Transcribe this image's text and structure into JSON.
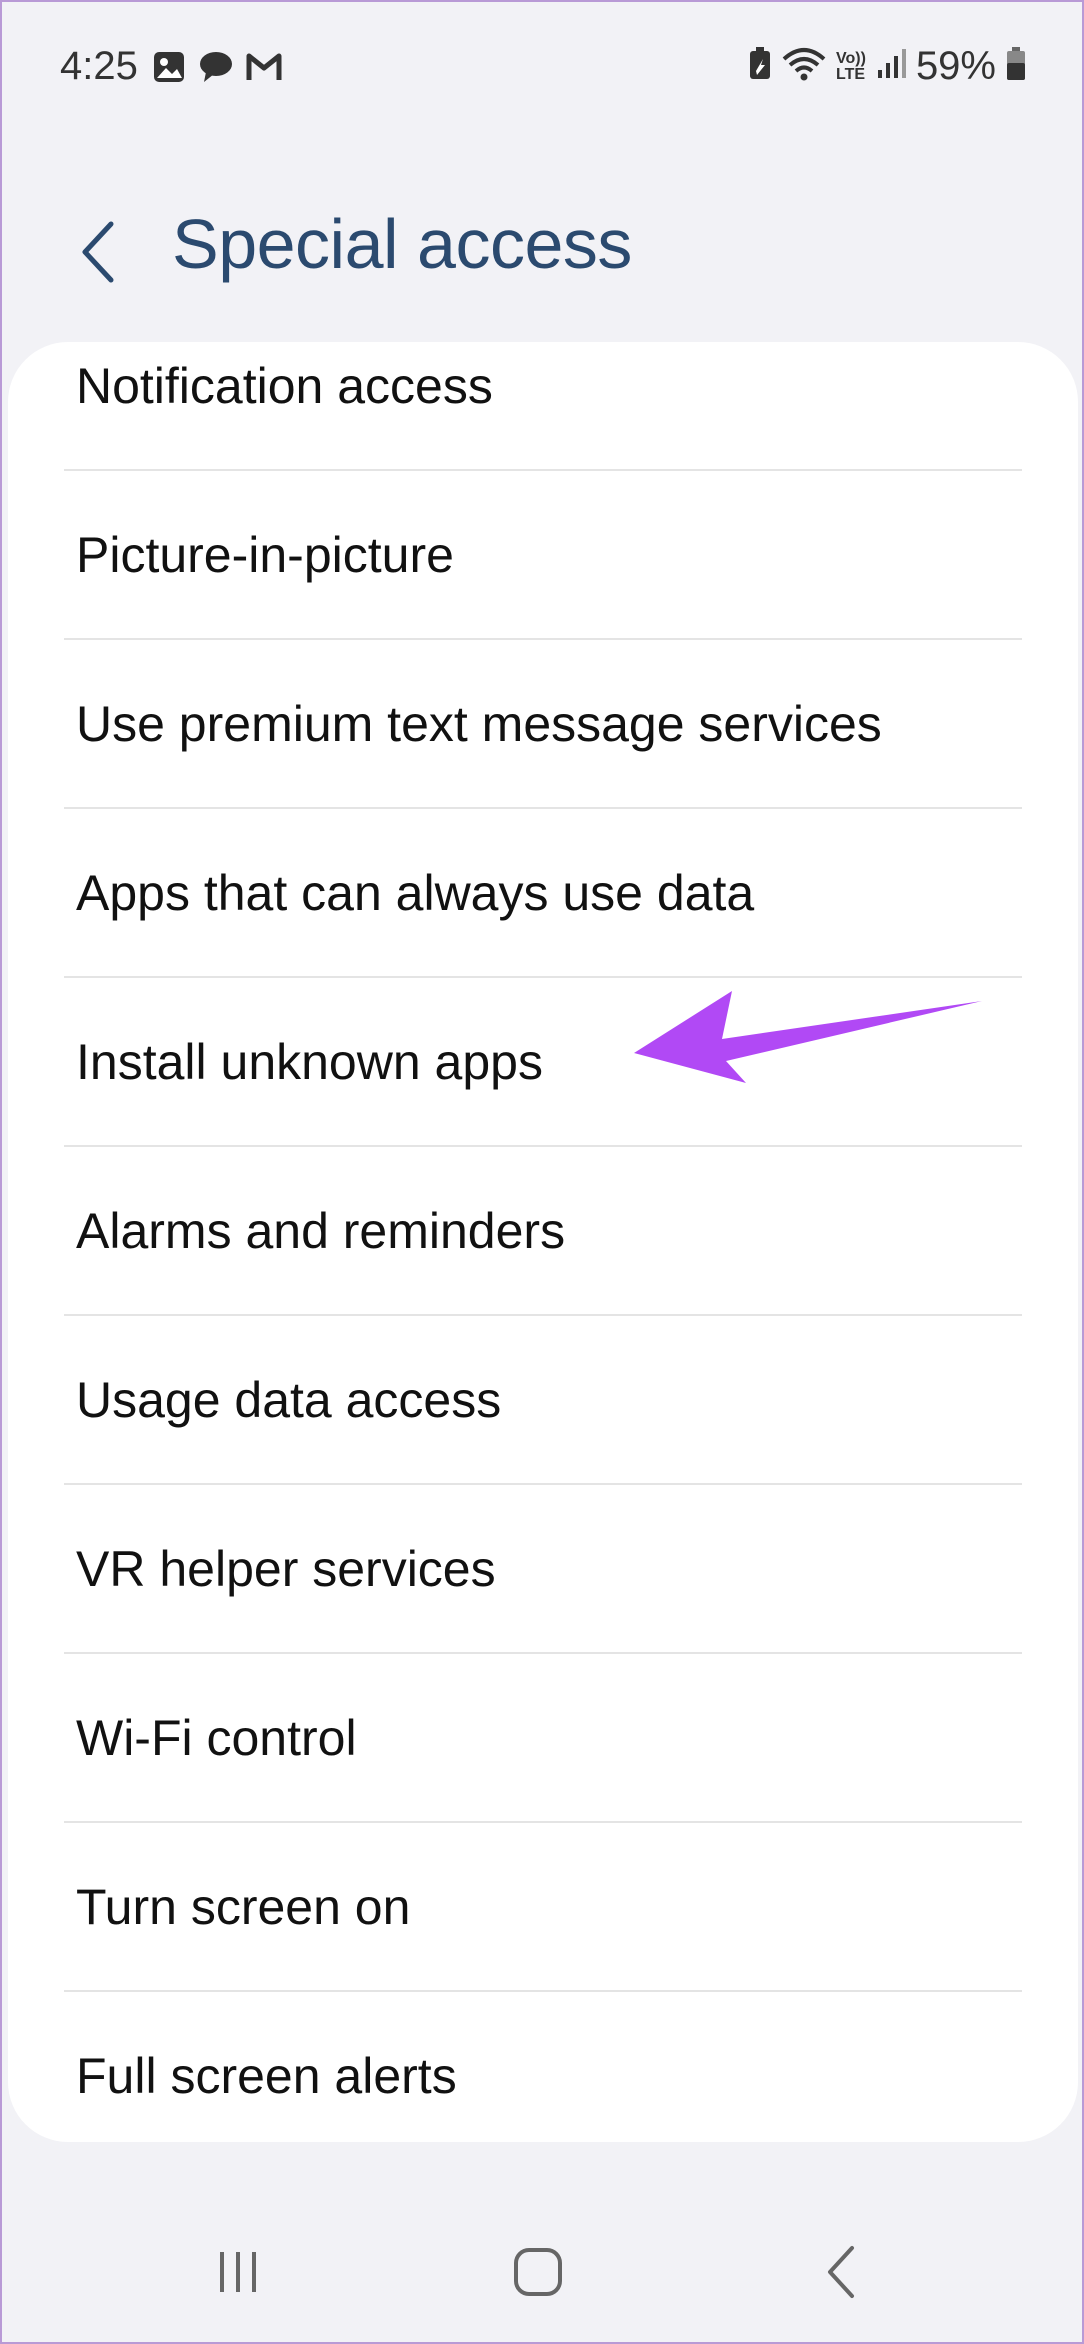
{
  "status_bar": {
    "time": "4:25",
    "left_icons": [
      "gallery-icon",
      "chat-icon",
      "gmail-icon"
    ],
    "right_icons": [
      "battery-saver-icon",
      "wifi-icon",
      "volte-icon",
      "signal-icon"
    ],
    "volte_top": "Vo))",
    "volte_bottom": "LTE",
    "battery_percent": "59%"
  },
  "header": {
    "title": "Special access"
  },
  "list": {
    "items": [
      {
        "label": "Notification access"
      },
      {
        "label": "Picture-in-picture"
      },
      {
        "label": "Use premium text message services"
      },
      {
        "label": "Apps that can always use data"
      },
      {
        "label": "Install unknown apps"
      },
      {
        "label": "Alarms and reminders"
      },
      {
        "label": "Usage data access"
      },
      {
        "label": "VR helper services"
      },
      {
        "label": "Wi-Fi control"
      },
      {
        "label": "Turn screen on"
      },
      {
        "label": "Full screen alerts"
      }
    ]
  },
  "annotation": {
    "color": "#b149f5",
    "points_to": "Install unknown apps"
  },
  "nav_bar": {
    "buttons": [
      "recent-apps-icon",
      "home-icon",
      "back-icon"
    ]
  }
}
